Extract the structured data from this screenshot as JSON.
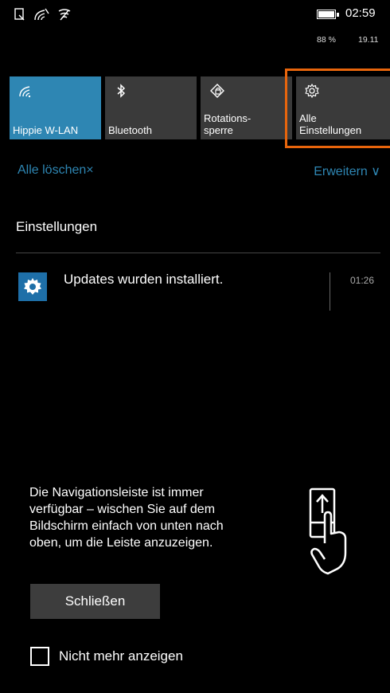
{
  "statusbar": {
    "time": "02:59",
    "battery_percent": "88 %",
    "date": "19.11",
    "icons": [
      "notification-icon",
      "signal-icon",
      "wifi-icon"
    ]
  },
  "quick_actions": [
    {
      "label_line1": "Hippie W-LAN",
      "label_line2": "",
      "icon": "wifi-icon",
      "active": true
    },
    {
      "label_line1": "Bluetooth",
      "label_line2": "",
      "icon": "bluetooth-icon",
      "active": false
    },
    {
      "label_line1": "Rotations-",
      "label_line2": "sperre",
      "icon": "rotation-lock-icon",
      "active": false
    },
    {
      "label_line1": "Alle",
      "label_line2": "Einstellungen",
      "icon": "gear-icon",
      "active": false
    }
  ],
  "actions": {
    "clear_all": "Alle löschen",
    "clear_icon": "×",
    "expand": "Erweitern",
    "expand_icon": "∨"
  },
  "notifications": {
    "group_title": "Einstellungen",
    "items": [
      {
        "text": "Updates wurden installiert.",
        "time": "01:26",
        "icon": "gear-icon"
      }
    ]
  },
  "tip": {
    "line1": "Die Navigationsleiste ist immer",
    "line2": "verfügbar – wischen Sie auf dem",
    "line3": "Bildschirm einfach von unten nach",
    "line4": "oben, um die Leiste anzuzeigen.",
    "icon": "swipe-up-phone-icon"
  },
  "close_button": "Schließen",
  "dont_show_again": "Nicht mehr anzeigen",
  "colors": {
    "accent": "#2e86b3",
    "tile": "#3a3a3a",
    "highlight": "#e8650c",
    "background": "#000000"
  }
}
